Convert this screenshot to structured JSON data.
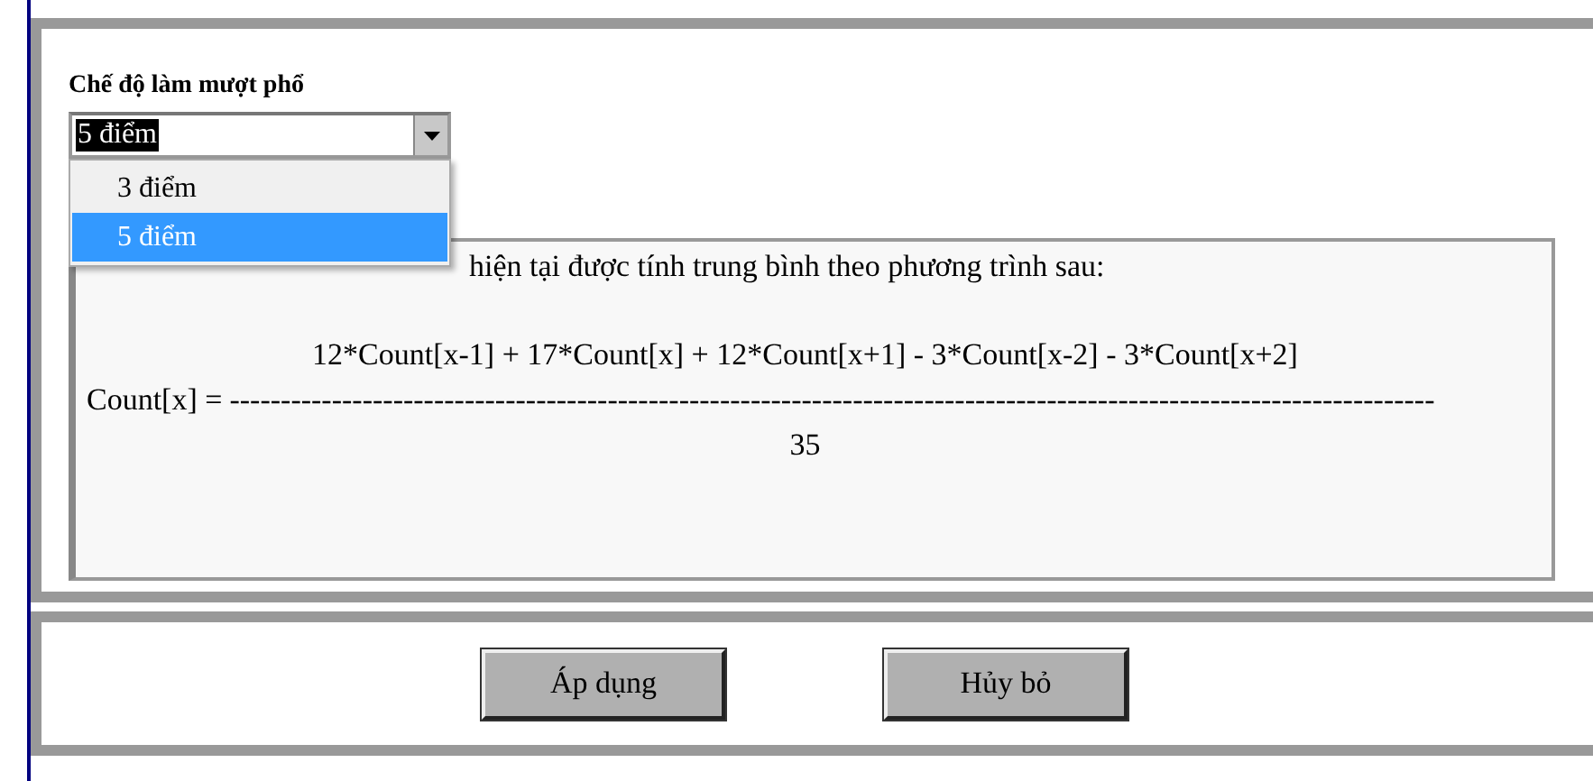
{
  "smoothing": {
    "label": "Chế độ làm mượt phổ",
    "value": "5 điểm",
    "options": [
      {
        "label": "3 điểm",
        "selected": false
      },
      {
        "label": "5 điểm",
        "selected": true
      }
    ]
  },
  "description": {
    "intro": "hiện tại được tính trung bình theo phương trình sau:",
    "numerator": "12*Count[x-1] + 17*Count[x] + 12*Count[x+1] - 3*Count[x-2] - 3*Count[x+2]",
    "lhs": "Count[x] =",
    "fraction_line": "----------------------------------------------------------------------------------------------------------------------",
    "denominator": "35"
  },
  "buttons": [
    "Áp dụng",
    "Hủy bỏ"
  ]
}
